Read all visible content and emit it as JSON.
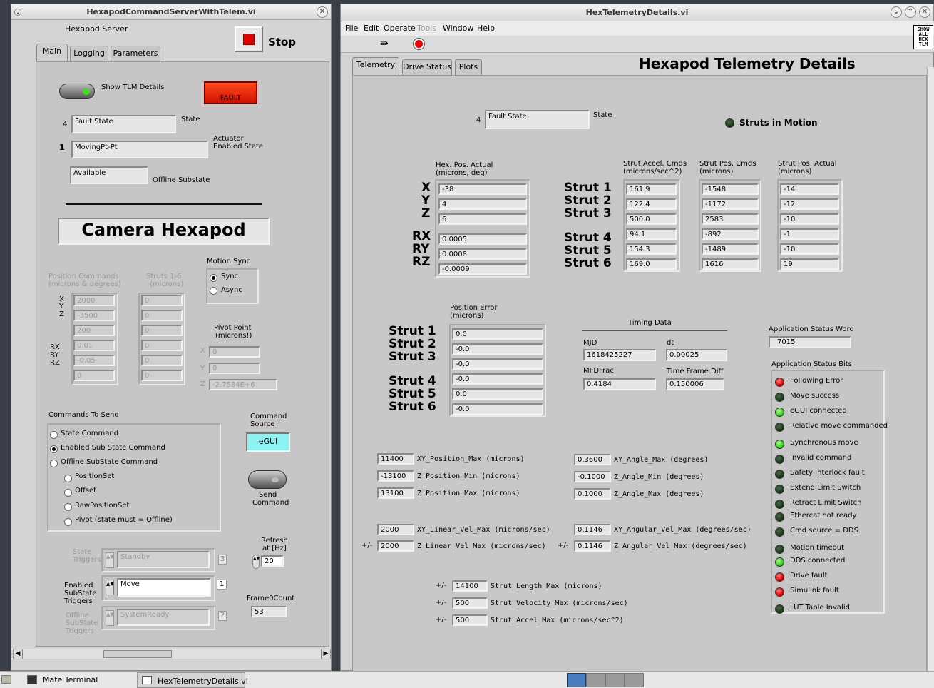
{
  "left": {
    "title": "HexapodCommandServerWithTelem.vi",
    "header_label": "Hexapod Server",
    "stop_label": "Stop",
    "tabs": [
      "Main",
      "Logging",
      "Parameters"
    ],
    "show_tlm_label": "Show TLM Details",
    "fault_label": "FAULT",
    "state_num": "4",
    "state_value": "Fault State",
    "state_label": "State",
    "actuator_num": "1",
    "actuator_value": "MovingPt-Pt",
    "actuator_label_1": "Actuator",
    "actuator_label_2": "Enabled State",
    "offline_value": "Available",
    "offline_label": "Offline Substate",
    "camera_title": "Camera Hexapod",
    "pos_cmds_label_1": "Position Commands",
    "pos_cmds_label_2": "(microns & degrees)",
    "struts_label_1": "Struts 1-6",
    "struts_label_2": "(microns)",
    "axis_labels": [
      "X",
      "Y",
      "Z",
      "RX",
      "RY",
      "RZ"
    ],
    "pos_values": [
      "2000",
      "-3500",
      "200",
      "0.01",
      "-0.05",
      "0"
    ],
    "strut_values": [
      "0",
      "0",
      "0",
      "0",
      "0",
      "0"
    ],
    "motion_sync_label": "Motion Sync",
    "sync_label": "Sync",
    "async_label": "Async",
    "pivot_label_1": "Pivot Point",
    "pivot_label_2": "(microns!)",
    "pivot_x_label": "X",
    "pivot_y_label": "Y",
    "pivot_z_label": "Z",
    "pivot_x": "0",
    "pivot_y": "0",
    "pivot_z": "-2.7584E+6",
    "commands_label": "Commands To Send",
    "cmd_options": [
      "State Command",
      "Enabled Sub State Command",
      "Offline SubState Command",
      "PositionSet",
      "Offset",
      "RawPositionSet",
      "Pivot (state must = Offline)"
    ],
    "cmd_source_label_1": "Command",
    "cmd_source_label_2": "Source",
    "egui_label": "eGUI",
    "send_label_1": "Send",
    "send_label_2": "Command",
    "state_triggers_label_1": "State",
    "state_triggers_label_2": "Triggers",
    "state_triggers_value": "Standby",
    "state_triggers_num": "3",
    "enabled_triggers_label_1": "Enabled",
    "enabled_triggers_label_2": "SubState",
    "enabled_triggers_label_3": "Triggers",
    "enabled_triggers_value": "Move",
    "enabled_triggers_num": "1",
    "offline_triggers_label_1": "Offline",
    "offline_triggers_label_2": "SubState",
    "offline_triggers_label_3": "Triggers",
    "offline_triggers_value": "SystemReady",
    "offline_triggers_num": "2",
    "refresh_label_1": "Refresh",
    "refresh_label_2": "at [Hz]",
    "refresh_value": "20",
    "frame_label": "Frame0Count",
    "frame_value": "53"
  },
  "right": {
    "title": "HexTelemetryDetails.vi",
    "menu": [
      "File",
      "Edit",
      "Operate",
      "Tools",
      "Window",
      "Help"
    ],
    "show_all_label": "SHOW ALL HEX TLM",
    "tabs": [
      "Telemetry",
      "Drive Status",
      "Plots"
    ],
    "heading": "Hexapod Telemetry Details",
    "state_num": "4",
    "state_value": "Fault State",
    "state_label": "State",
    "struts_motion_label": "Struts in Motion",
    "hex_pos_label_1": "Hex. Pos. Actual",
    "hex_pos_label_2": "(microns, deg)",
    "axis_labels": [
      "X",
      "Y",
      "Z",
      "RX",
      "RY",
      "RZ"
    ],
    "hex_pos_values": [
      "-38",
      "4",
      "6",
      "0.0005",
      "0.0008",
      "-0.0009"
    ],
    "strut_names": [
      "Strut 1",
      "Strut 2",
      "Strut 3",
      "Strut 4",
      "Strut 5",
      "Strut 6"
    ],
    "accel_label_1": "Strut Accel. Cmds",
    "accel_label_2": "(microns/sec^2)",
    "accel_values": [
      "161.9",
      "122.4",
      "500.0",
      "94.1",
      "154.3",
      "169.0"
    ],
    "poscmd_label_1": "Strut Pos. Cmds",
    "poscmd_label_2": "(microns)",
    "poscmd_values": [
      "-1548",
      "-1172",
      "2583",
      "-892",
      "-1489",
      "1616"
    ],
    "posact_label_1": "Strut Pos. Actual",
    "posact_label_2": "(microns)",
    "posact_values": [
      "-14",
      "-12",
      "-10",
      "-1",
      "-10",
      "19"
    ],
    "pos_err_label_1": "Position Error",
    "pos_err_label_2": "(microns)",
    "pos_err_values": [
      "0.0",
      "-0.0",
      "-0.0",
      "-0.0",
      "0.0",
      "-0.0"
    ],
    "timing_label": "Timing Data",
    "mjd_label": "MJD",
    "mjd_value": "1618425227",
    "dt_label": "dt",
    "dt_value": "0.00025",
    "mfdfrac_label": "MFDFrac",
    "mfdfrac_value": "0.4184",
    "tfd_label": "Time Frame Diff",
    "tfd_value": "0.150006",
    "app_word_label": "Application Status Word",
    "app_word_value": "7015",
    "app_bits_label": "Application Status Bits",
    "status_bits": [
      {
        "label": "Following Error",
        "color": "red"
      },
      {
        "label": "Move success",
        "color": "dark"
      },
      {
        "label": "eGUI connected",
        "color": "green"
      },
      {
        "label": "Relative move commanded",
        "color": "dark"
      },
      {
        "label": "Synchronous move",
        "color": "green"
      },
      {
        "label": "Invalid command",
        "color": "dark"
      },
      {
        "label": "Safety Interlock fault",
        "color": "dark"
      },
      {
        "label": "Extend Limit Switch",
        "color": "dark"
      },
      {
        "label": "Retract Limit Switch",
        "color": "dark"
      },
      {
        "label": "Ethercat not ready",
        "color": "dark"
      },
      {
        "label": "Cmd source = DDS",
        "color": "dark"
      },
      {
        "label": "Motion timeout",
        "color": "dark"
      },
      {
        "label": "DDS connected",
        "color": "green"
      },
      {
        "label": "Drive fault",
        "color": "red"
      },
      {
        "label": "Simulink fault",
        "color": "red"
      },
      {
        "label": "LUT Table Invalid",
        "color": "dark"
      }
    ],
    "limits_left": [
      {
        "value": "11400",
        "label": "XY_Position_Max (microns)"
      },
      {
        "value": "-13100",
        "label": "Z_Position_Min (microns)"
      },
      {
        "value": "13100",
        "label": "Z_Position_Max (microns)"
      }
    ],
    "limits_right": [
      {
        "value": "0.3600",
        "label": "XY_Angle_Max (degrees)"
      },
      {
        "value": "-0.1000",
        "label": "Z_Angle_Min (degrees)"
      },
      {
        "value": "0.1000",
        "label": "Z_Angle_Max (degrees)"
      }
    ],
    "pm": "+/-",
    "vel_left": [
      {
        "value": "2000",
        "label": "XY_Linear_Vel_Max (microns/sec)"
      },
      {
        "value": "2000",
        "label": "Z_Linear_Vel_Max (microns/sec)"
      }
    ],
    "vel_right": [
      {
        "value": "0.1146",
        "label": "XY_Angular_Vel_Max (degrees/sec)"
      },
      {
        "value": "0.1146",
        "label": "Z_Angular_Vel_Max (degrees/sec)"
      }
    ],
    "strut_limits": [
      {
        "value": "14100",
        "label": "Strut_Length_Max (microns)"
      },
      {
        "value": "500",
        "label": "Strut_Velocity_Max (microns/sec)"
      },
      {
        "value": "500",
        "label": "Strut_Accel_Max (microns/sec^2)"
      }
    ]
  },
  "taskbar": {
    "items": [
      "Mate Terminal",
      "HexTelemetryDetails.vi"
    ]
  }
}
